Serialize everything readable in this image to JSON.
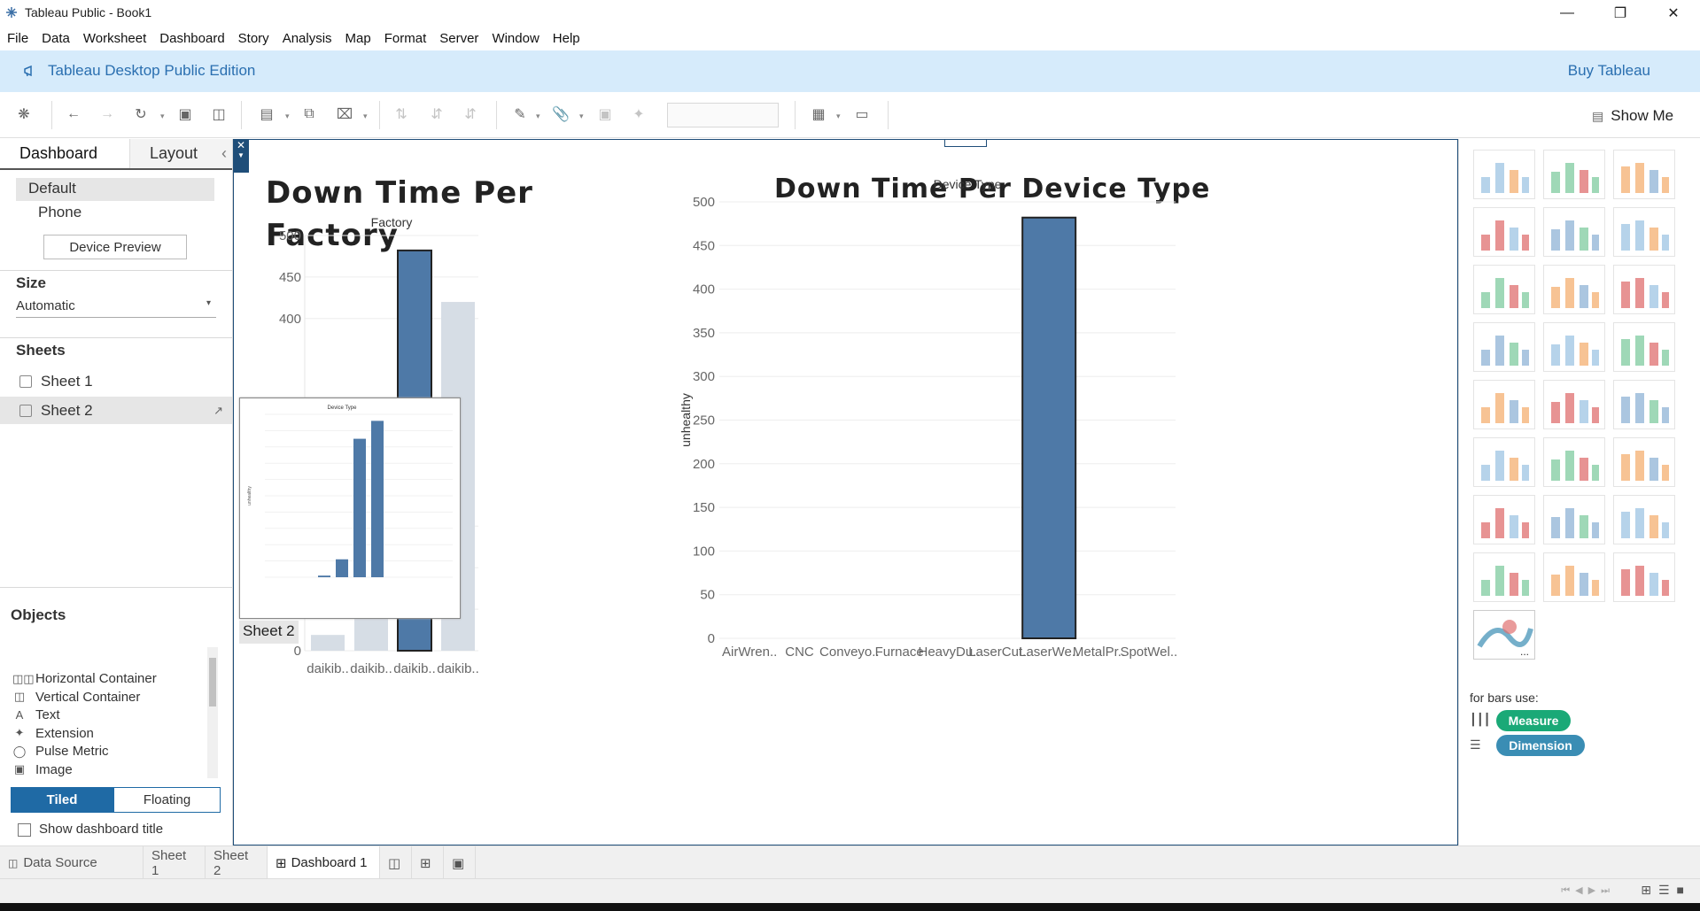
{
  "window": {
    "title": "Tableau Public - Book1"
  },
  "menu": [
    "File",
    "Data",
    "Worksheet",
    "Dashboard",
    "Story",
    "Analysis",
    "Map",
    "Format",
    "Server",
    "Window",
    "Help"
  ],
  "banner": {
    "edition": "Tableau Desktop Public Edition",
    "buy": "Buy Tableau"
  },
  "toolbar": {
    "show_me": "Show Me"
  },
  "left_panel": {
    "tabs": [
      "Dashboard",
      "Layout"
    ],
    "device": {
      "default": "Default",
      "phone": "Phone",
      "preview_button": "Device Preview"
    },
    "size": {
      "header": "Size",
      "value": "Automatic"
    },
    "sheets": {
      "header": "Sheets",
      "items": [
        "Sheet 1",
        "Sheet 2"
      ]
    },
    "objects": {
      "header": "Objects",
      "items": [
        "Horizontal Container",
        "Vertical Container",
        "Text",
        "Extension",
        "Pulse Metric",
        "Image"
      ],
      "tiled": "Tiled",
      "floating": "Floating",
      "show_title": "Show dashboard title"
    }
  },
  "dashboard": {
    "left_title": "Down Time Per Factory",
    "right_title": "Down Time Per Device Type",
    "floating_label": "Sheet 2"
  },
  "chart_data": [
    {
      "type": "bar",
      "title": "Factory",
      "xlabel": "",
      "ylabel": "",
      "categories": [
        "daikib..",
        "daikib..",
        "daikib..",
        "daikib.."
      ],
      "values": [
        19,
        110,
        482,
        420
      ],
      "highlighted": [
        false,
        false,
        true,
        false
      ],
      "yticks": [
        0,
        50,
        100,
        150,
        400,
        450,
        500
      ],
      "ylim": [
        0,
        500
      ],
      "grid": true
    },
    {
      "type": "bar",
      "title": "Device Type",
      "xlabel": "",
      "ylabel": "unhealthy",
      "categories": [
        "AirWren..",
        "CNC",
        "Conveyo..",
        "Furnace",
        "HeavyDu..",
        "LaserCut..",
        "LaserWe..",
        "MetalPr..",
        "SpotWel.."
      ],
      "values": [
        0,
        0,
        0,
        0,
        0,
        0,
        482,
        0,
        0
      ],
      "yticks": [
        0,
        50,
        100,
        150,
        200,
        250,
        300,
        350,
        400,
        450,
        500
      ],
      "ylim": [
        0,
        500
      ],
      "grid": true
    }
  ],
  "thumbnail_chart": {
    "title": "Device Type",
    "ylabel": "unhealthy",
    "values": [
      5,
      55,
      425,
      480
    ]
  },
  "show_me_panel": {
    "hint": "for bars use:",
    "measure": "Measure",
    "dimension": "Dimension",
    "colors": {
      "measure": "#1aa977",
      "dimension": "#3a8db4"
    }
  },
  "bottom_tabs": [
    "Data Source",
    "Sheet 1",
    "Sheet 2",
    "Dashboard 1"
  ],
  "colors": {
    "bar_highlight": "#4e79a7",
    "bar_muted": "#d6dde5",
    "accent": "#1f6aa5"
  }
}
